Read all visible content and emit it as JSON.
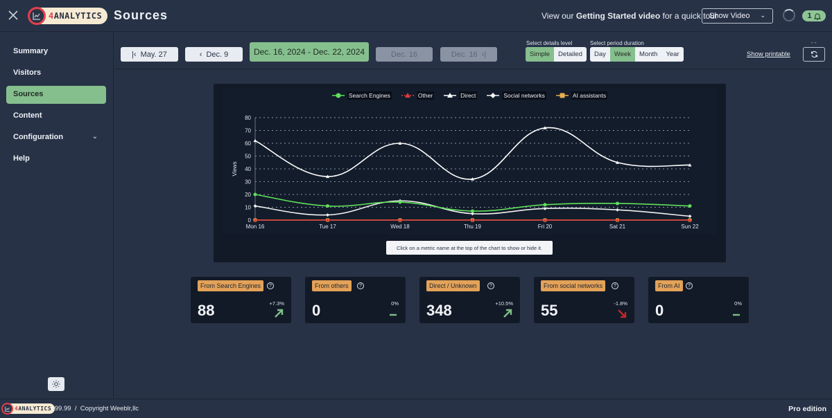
{
  "header": {
    "app_name_prefix": "4",
    "app_name_rest": "ANALYTICS",
    "page_title": "Sources",
    "promo_prefix": "View our ",
    "promo_bold": "Getting Started video",
    "promo_suffix": " for a quick tour",
    "show_video_label": "Show Video",
    "notification_count": "1"
  },
  "sidebar": {
    "items": [
      {
        "label": "Summary"
      },
      {
        "label": "Visitors"
      },
      {
        "label": "Sources",
        "active": true
      },
      {
        "label": "Content"
      },
      {
        "label": "Configuration",
        "expandable": true
      },
      {
        "label": "Help"
      }
    ]
  },
  "toolbar": {
    "first_label": "May. 27",
    "prev_label": "Dec. 9",
    "current_period": "Dec. 16, 2024 - Dec. 22, 2024",
    "next_label": "Dec. 16",
    "last_label": "Dec. 16",
    "details_level_label": "Select details level",
    "details_options": [
      "Simple",
      "Detailed"
    ],
    "details_selected": "Simple",
    "period_label": "Select period duration",
    "period_options": [
      "Day",
      "Week",
      "Month",
      "Year"
    ],
    "period_selected": "Week",
    "show_printable": "Show printable",
    "refresh_status": "- -"
  },
  "chart_data": {
    "type": "line",
    "title": "",
    "xlabel": "",
    "ylabel": "Views",
    "ylim": [
      0,
      80
    ],
    "yticks": [
      0,
      10,
      20,
      30,
      40,
      50,
      60,
      70,
      80
    ],
    "grid": true,
    "legend_position": "top-center",
    "categories": [
      "Mon 16",
      "Tue 17",
      "Wed 18",
      "Thu 19",
      "Fri 20",
      "Sat 21",
      "Sun 22"
    ],
    "series": [
      {
        "name": "Search Engines",
        "color": "#5fe05a",
        "marker": "circle",
        "values": [
          20,
          11,
          14,
          7,
          12,
          13,
          11
        ]
      },
      {
        "name": "Other",
        "color": "#e03c3c",
        "marker": "triangle",
        "dashed": true,
        "values": [
          0,
          0,
          0,
          0,
          0,
          0,
          0
        ]
      },
      {
        "name": "Direct",
        "color": "#ffffff",
        "marker": "triangle",
        "values": [
          62,
          34,
          60,
          32,
          72,
          45,
          43
        ]
      },
      {
        "name": "Social networks",
        "color": "#f2f2f2",
        "marker": "diamond",
        "values": [
          11,
          4,
          15,
          5,
          9,
          8,
          3
        ]
      },
      {
        "name": "AI assistants",
        "color": "#e8b04c",
        "marker": "square",
        "values": [
          0,
          0,
          0,
          0,
          0,
          0,
          0
        ]
      }
    ]
  },
  "chart_hint": "Click on a metric name at the top of the chart to show or hide it.",
  "stats": [
    {
      "label": "From Search Engines",
      "value": "88",
      "change": "+7.3%",
      "trend": "up"
    },
    {
      "label": "From others",
      "value": "0",
      "change": "0%",
      "trend": "flat"
    },
    {
      "label": "Direct / Unknown",
      "value": "348",
      "change": "+10.5%",
      "trend": "up"
    },
    {
      "label": "From social networks",
      "value": "55",
      "change": "-1.8%",
      "trend": "down"
    },
    {
      "label": "From AI",
      "value": "0",
      "change": "0%",
      "trend": "flat"
    }
  ],
  "colors": {
    "accent_green": "#86bf8e",
    "badge_orange": "#e3a257",
    "trend_up": "#7fbf86",
    "trend_down": "#c0282a",
    "brand_red": "#e43f4b"
  },
  "footer": {
    "version": "v99.99",
    "separator": "/",
    "copyright": "Copyright Weeblr,llc",
    "edition": "Pro edition"
  }
}
